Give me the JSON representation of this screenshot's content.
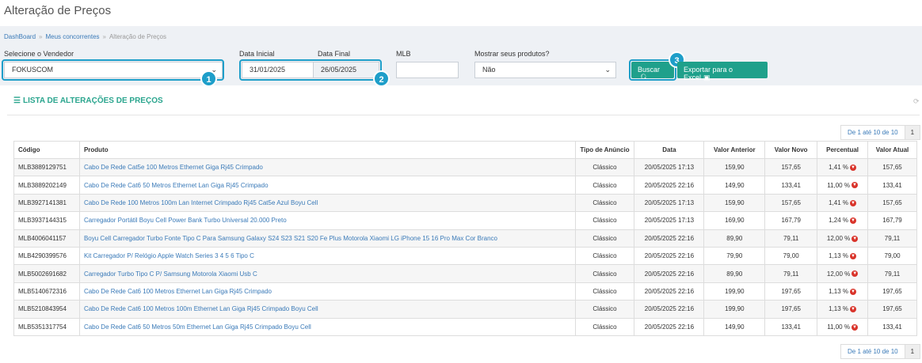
{
  "page_title": "Alteração de Preços",
  "breadcrumb": {
    "items": [
      "DashBoard",
      "Meus concorrentes"
    ],
    "current": "Alteração de Preços",
    "separator": "»"
  },
  "filters": {
    "vendedor": {
      "label": "Selecione o Vendedor",
      "value": "FOKUSCOM"
    },
    "data_inicial": {
      "label": "Data Inicial",
      "value": "31/01/2025"
    },
    "data_final": {
      "label": "Data Final",
      "value": "26/05/2025"
    },
    "mlb": {
      "label": "MLB",
      "value": ""
    },
    "mostrar": {
      "label": "Mostrar seus produtos?",
      "value": "Não"
    }
  },
  "buttons": {
    "buscar": "Buscar",
    "exportar": "Exportar para o Excel"
  },
  "badges": [
    "1",
    "2",
    "3"
  ],
  "list": {
    "title": "LISTA DE ALTERAÇÕES DE PREÇOS"
  },
  "pagination": {
    "info": "De 1 até 10 de 10",
    "page": "1"
  },
  "table": {
    "columns": [
      "Código",
      "Produto",
      "Tipo de Anúncio",
      "Data",
      "Valor Anterior",
      "Valor Novo",
      "Percentual",
      "Valor Atual"
    ],
    "rows": [
      [
        "MLB3889129751",
        "Cabo De Rede Cat5e 100 Metros Ethernet Giga Rj45 Crimpado",
        "Clássico",
        "20/05/2025 17:13",
        "159,90",
        "157,65",
        "1,41 %",
        "157,65"
      ],
      [
        "MLB3889202149",
        "Cabo De Rede Cat6 50 Metros Ethernet Lan Giga Rj45 Crimpado",
        "Clássico",
        "20/05/2025 22:16",
        "149,90",
        "133,41",
        "11,00 %",
        "133,41"
      ],
      [
        "MLB3927141381",
        "Cabo De Rede 100 Metros 100m Lan Internet Crimpado Rj45 Cat5e Azul Boyu Cell",
        "Clássico",
        "20/05/2025 17:13",
        "159,90",
        "157,65",
        "1,41 %",
        "157,65"
      ],
      [
        "MLB3937144315",
        "Carregador Portátil Boyu Cell Power Bank Turbo Universal 20.000 Preto",
        "Clássico",
        "20/05/2025 17:13",
        "169,90",
        "167,79",
        "1,24 %",
        "167,79"
      ],
      [
        "MLB4006041157",
        "Boyu Cell Carregador Turbo Fonte Tipo C Para Samsung Galaxy S24 S23 S21 S20 Fe Plus Motorola Xiaomi LG iPhone 15 16 Pro Max Cor Branco",
        "Clássico",
        "20/05/2025 22:16",
        "89,90",
        "79,11",
        "12,00 %",
        "79,11"
      ],
      [
        "MLB4290399576",
        "Kit Carregador P/ Relógio Apple Watch Series 3 4 5 6 Tipo C",
        "Clássico",
        "20/05/2025 22:16",
        "79,90",
        "79,00",
        "1,13 %",
        "79,00"
      ],
      [
        "MLB5002691682",
        "Carregador Turbo Tipo C P/ Samsung Motorola Xiaomi Usb C",
        "Clássico",
        "20/05/2025 22:16",
        "89,90",
        "79,11",
        "12,00 %",
        "79,11"
      ],
      [
        "MLB5140672316",
        "Cabo De Rede Cat6 100 Metros Ethernet Lan Giga Rj45 Crimpado",
        "Clássico",
        "20/05/2025 22:16",
        "199,90",
        "197,65",
        "1,13 %",
        "197,65"
      ],
      [
        "MLB5210843954",
        "Cabo De Rede Cat6 100 Metros 100m Ethernet Lan Giga Rj45 Crimpado Boyu Cell",
        "Clássico",
        "20/05/2025 22:16",
        "199,90",
        "197,65",
        "1,13 %",
        "197,65"
      ],
      [
        "MLB5351317754",
        "Cabo De Rede Cat6 50 Metros 50m Ethernet Lan Giga Rj45 Crimpado Boyu Cell",
        "Clássico",
        "20/05/2025 22:16",
        "149,90",
        "133,41",
        "11,00 %",
        "133,41"
      ]
    ]
  },
  "icons": {
    "list": "list-icon",
    "search": "search-icon",
    "excel": "excel-icon",
    "refresh": "refresh-icon",
    "decrease": "arrow-down-circle-icon"
  },
  "colors": {
    "accent": "#1fa08b",
    "highlight": "#1e9ec9",
    "link": "#3a7ab8",
    "decrease": "#d9342b"
  }
}
